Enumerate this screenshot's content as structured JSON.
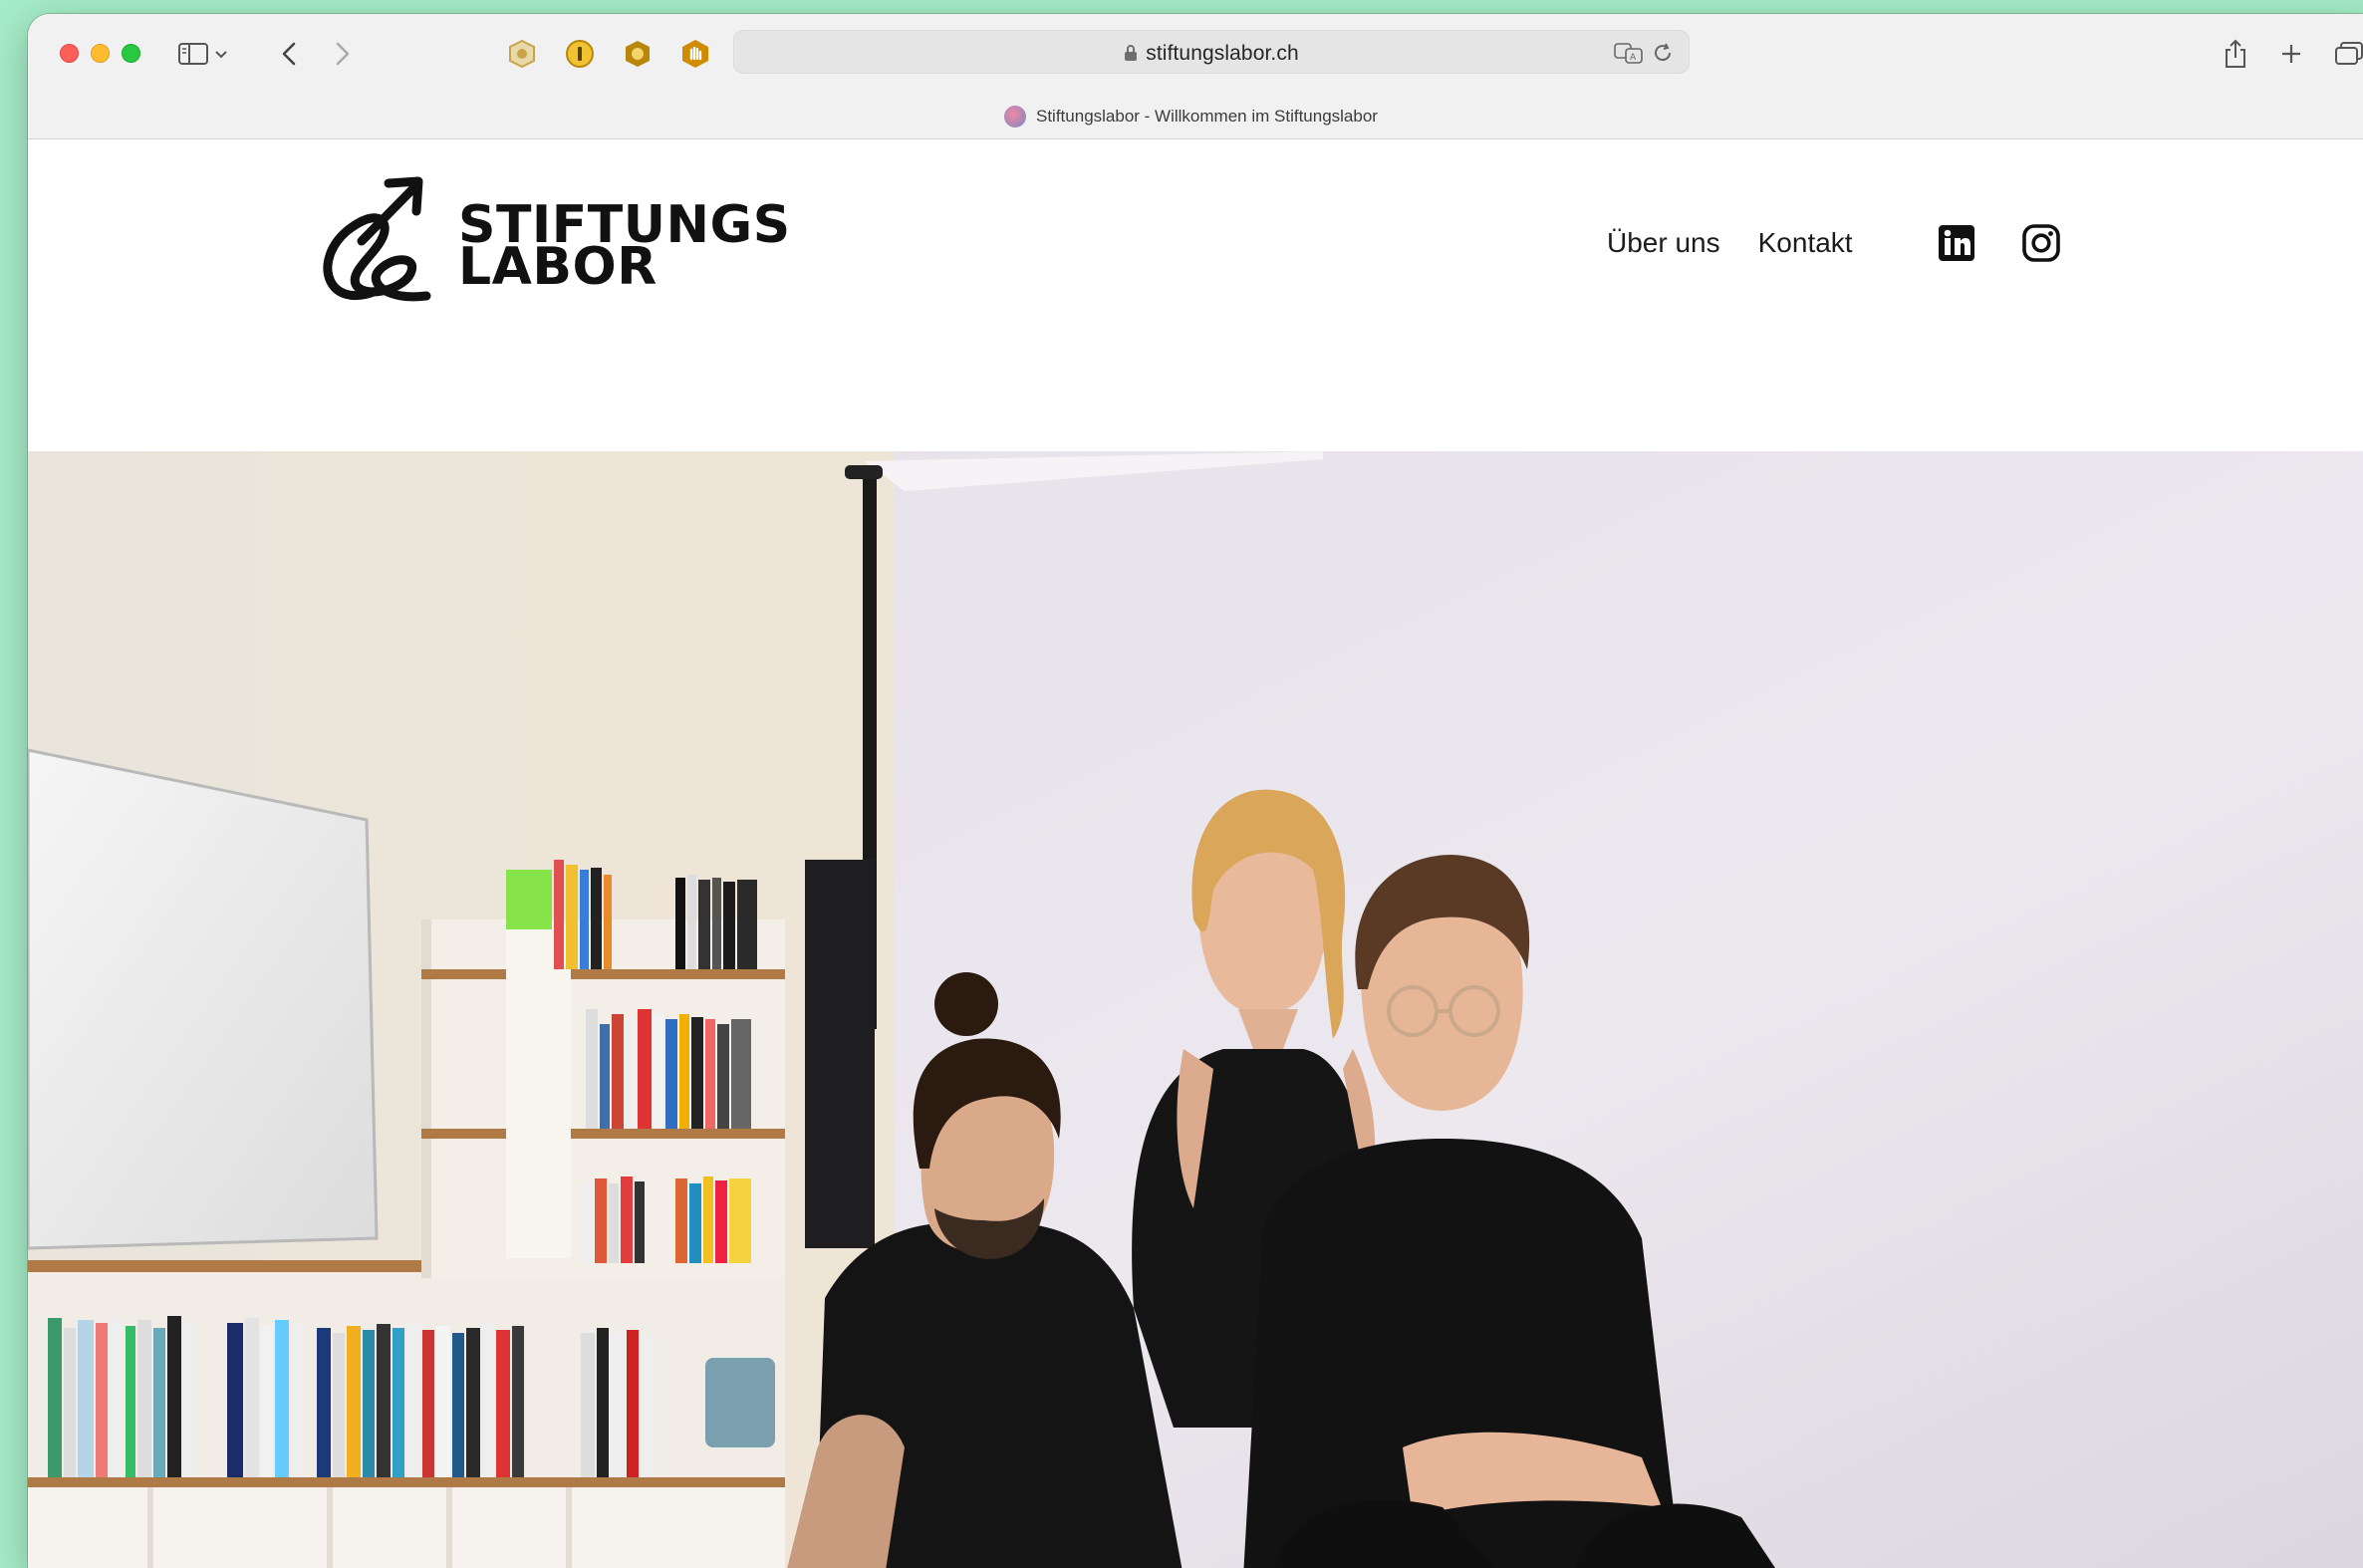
{
  "browser": {
    "url": "stiftungslabor.ch",
    "tab_title": "Stiftungslabor - Willkommen im Stiftungslabor",
    "icons": [
      "sidebar-icon",
      "chevron-down-icon",
      "back-icon",
      "forward-icon",
      "extension-shield-icon",
      "extension-1password-icon",
      "extension-badge-icon",
      "extension-hand-icon",
      "lock-icon",
      "translate-icon",
      "reload-icon",
      "share-icon",
      "new-tab-icon",
      "tab-overview-icon"
    ]
  },
  "site": {
    "logo": {
      "line1": "STIFTUNGS",
      "line2": "LABOR"
    },
    "nav": [
      {
        "label": "Über uns"
      },
      {
        "label": "Kontakt"
      }
    ],
    "social": [
      "linkedin-icon",
      "instagram-icon"
    ]
  },
  "hero": {
    "image": "team-photo",
    "description_colors": {
      "wall": "#e7e2ea",
      "left_wall": "#ece4da",
      "clothing": "#121212"
    }
  }
}
